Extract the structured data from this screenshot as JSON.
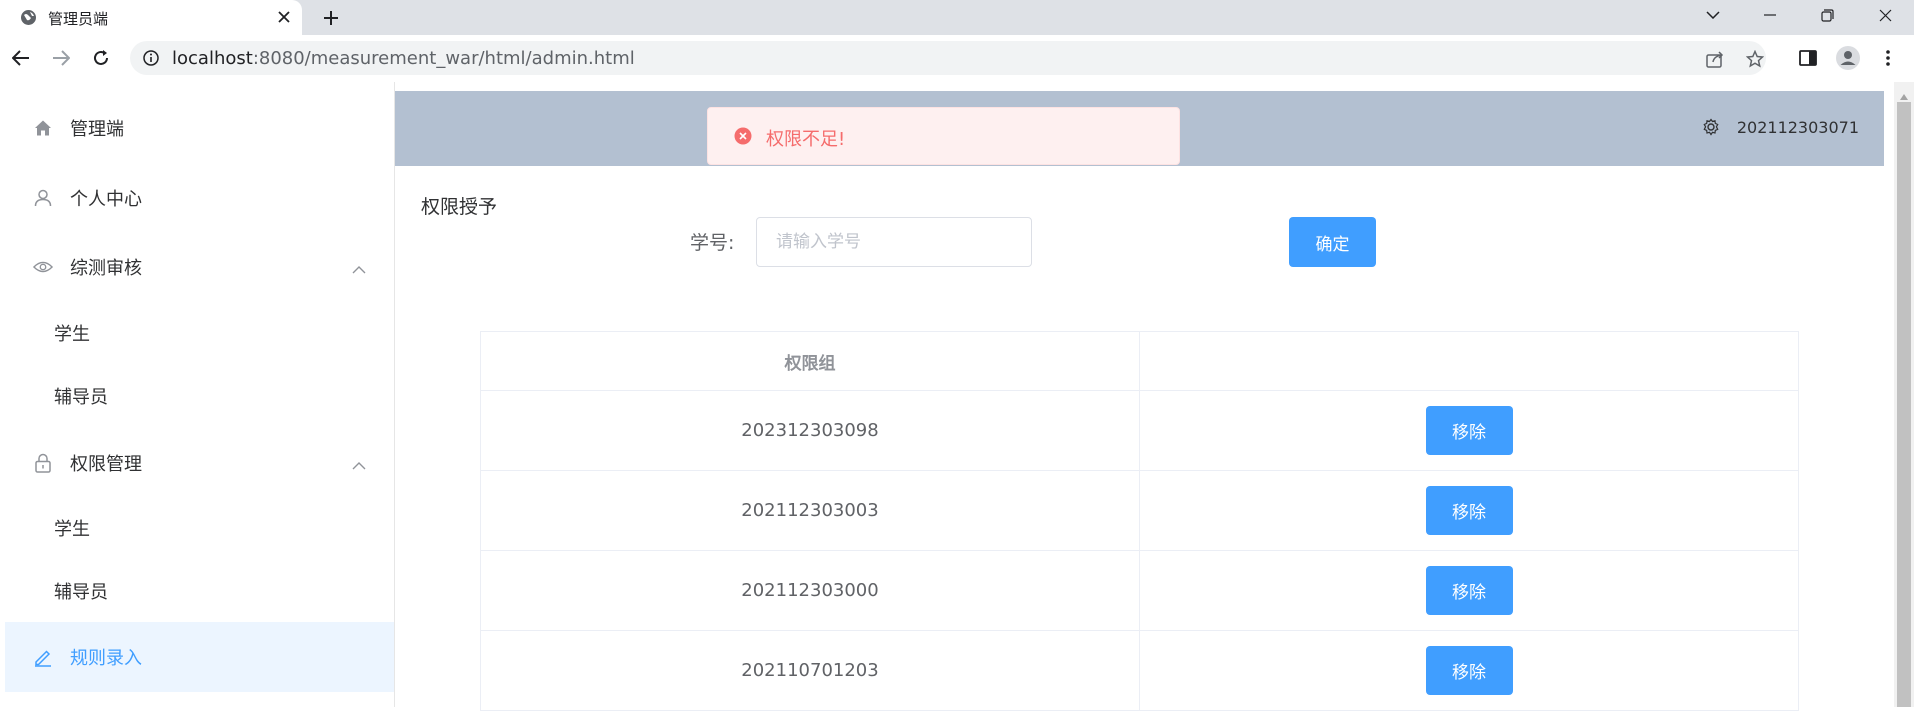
{
  "browser": {
    "tab_title": "管理员端",
    "url_host": "localhost",
    "url_rest": ":8080/measurement_war/html/admin.html"
  },
  "sidebar": {
    "items": [
      {
        "label": "管理端",
        "icon": "home-icon"
      },
      {
        "label": "个人中心",
        "icon": "user-icon"
      },
      {
        "label": "综测审核",
        "icon": "eye-icon",
        "children": [
          "学生",
          "辅导员"
        ]
      },
      {
        "label": "权限管理",
        "icon": "lock-icon",
        "children": [
          "学生",
          "辅导员"
        ]
      },
      {
        "label": "规则录入",
        "icon": "edit-icon",
        "active": true
      }
    ]
  },
  "header": {
    "username": "202112303071",
    "settings_icon": "gear-icon"
  },
  "toast": {
    "type": "error",
    "message": "权限不足!"
  },
  "main": {
    "section_title": "权限授予",
    "form": {
      "label": "学号:",
      "placeholder": "请输入学号",
      "value": "",
      "confirm_label": "确定"
    },
    "table": {
      "headers": [
        "权限组",
        ""
      ],
      "rows": [
        {
          "id": "202312303098",
          "action": "移除"
        },
        {
          "id": "202112303003",
          "action": "移除"
        },
        {
          "id": "202112303000",
          "action": "移除"
        },
        {
          "id": "202110701203",
          "action": "移除"
        }
      ]
    }
  },
  "colors": {
    "primary": "#409eff",
    "header_bg": "#b3c0d1",
    "error": "#f56c6c",
    "active_bg": "#ecf5ff"
  }
}
